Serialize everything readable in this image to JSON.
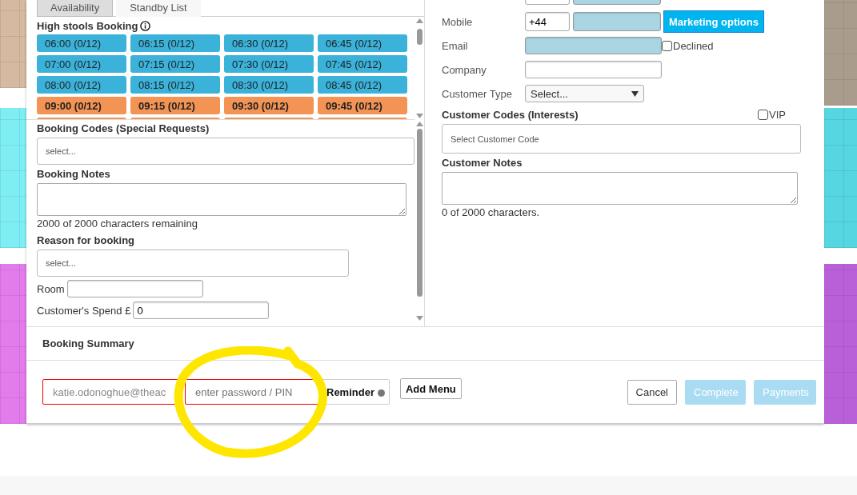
{
  "tabs": [
    {
      "label": "Availability",
      "selected": true
    },
    {
      "label": "Standby List",
      "selected": false
    }
  ],
  "slots_panel": {
    "title": "High stools Booking",
    "slots": [
      {
        "label": "06:00 (0/12)",
        "kind": "standard"
      },
      {
        "label": "06:15 (0/12)",
        "kind": "standard"
      },
      {
        "label": "06:30 (0/12)",
        "kind": "standard"
      },
      {
        "label": "06:45 (0/12)",
        "kind": "standard"
      },
      {
        "label": "07:00 (0/12)",
        "kind": "standard"
      },
      {
        "label": "07:15 (0/12)",
        "kind": "standard"
      },
      {
        "label": "07:30 (0/12)",
        "kind": "standard"
      },
      {
        "label": "07:45 (0/12)",
        "kind": "standard"
      },
      {
        "label": "08:00 (0/12)",
        "kind": "standard"
      },
      {
        "label": "08:15 (0/12)",
        "kind": "standard"
      },
      {
        "label": "08:30 (0/12)",
        "kind": "standard"
      },
      {
        "label": "08:45 (0/12)",
        "kind": "standard"
      },
      {
        "label": "09:00 (0/12)",
        "kind": "peak"
      },
      {
        "label": "09:15 (0/12)",
        "kind": "peak"
      },
      {
        "label": "09:30 (0/12)",
        "kind": "peak"
      },
      {
        "label": "09:45 (0/12)",
        "kind": "peak"
      },
      {
        "kind": "peak"
      },
      {
        "kind": "peak"
      },
      {
        "kind": "peak"
      },
      {
        "kind": "peak"
      }
    ]
  },
  "booking_form": {
    "booking_codes_label": "Booking Codes (Special Requests)",
    "booking_codes_placeholder": "select...",
    "notes_label": "Booking Notes",
    "notes_remaining": "2000 of 2000 characters remaining",
    "reason_label": "Reason for booking",
    "reason_placeholder": "select...",
    "room_label": "Room",
    "spend_label": "Customer's Spend £",
    "spend_value": "0"
  },
  "customer_form": {
    "mobile_label": "Mobile",
    "mobile_code": "+44",
    "marketing_button": "Marketing options",
    "email_label": "Email",
    "declined_label": "Declined",
    "declined_checked": false,
    "company_label": "Company",
    "customer_type_label": "Customer Type",
    "customer_type_value": "Select...",
    "codes_label": "Customer Codes (Interests)",
    "vip_label": "VIP",
    "vip_checked": false,
    "codes_placeholder": "Select Customer Code",
    "notes_label": "Customer Notes",
    "notes_count": "0 of 2000 characters."
  },
  "summary": {
    "title": "Booking Summary"
  },
  "footer": {
    "user_value": "katie.odonoghue@theac",
    "password_placeholder": "enter password / PIN",
    "reminder_button": "Reminder",
    "add_menu_button": "Add Menu",
    "cancel_button": "Cancel",
    "complete_button": {
      "label": "Complete",
      "disabled": true
    },
    "payments_button": {
      "label": "Payments",
      "disabled": true
    }
  }
}
